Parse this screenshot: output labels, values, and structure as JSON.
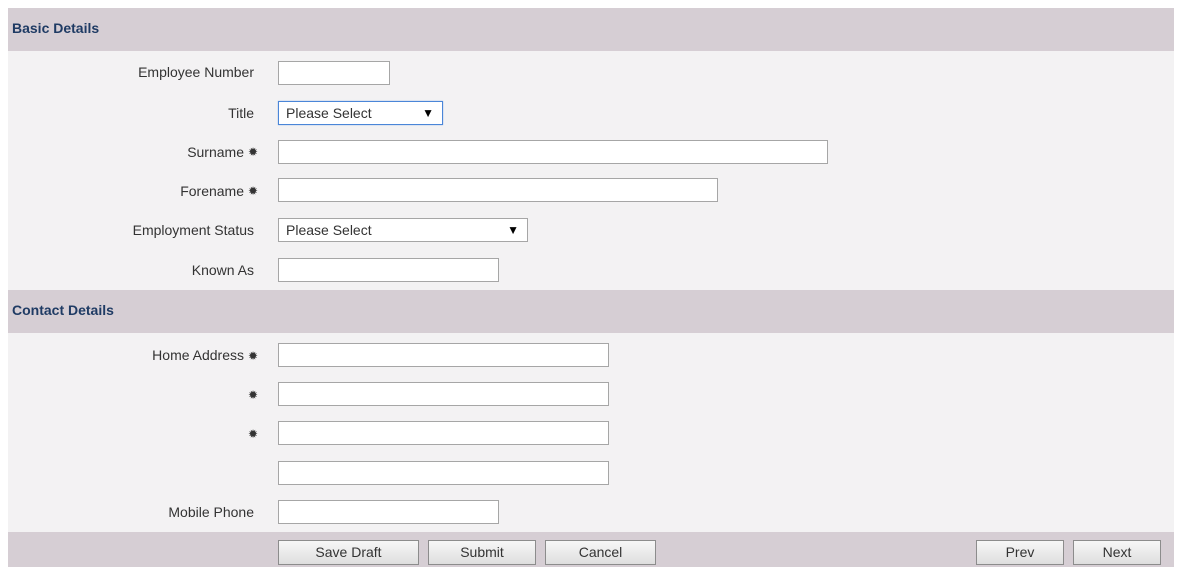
{
  "basic_details": {
    "title": "Basic Details",
    "fields": {
      "employee_number": {
        "label": "Employee Number",
        "value": ""
      },
      "title": {
        "label": "Title",
        "selected": "Please Select"
      },
      "surname": {
        "label": "Surname",
        "required_mark": "✹",
        "value": ""
      },
      "forename": {
        "label": "Forename",
        "required_mark": "✹",
        "value": ""
      },
      "employment_status": {
        "label": "Employment Status",
        "selected": "Please Select"
      },
      "known_as": {
        "label": "Known As",
        "value": ""
      }
    }
  },
  "contact_details": {
    "title": "Contact Details",
    "fields": {
      "home_address": {
        "label": "Home Address",
        "required_mark": "✹",
        "line1": "",
        "line2": "",
        "line3": "",
        "line4": ""
      },
      "address_line2_required_mark": "✹",
      "address_line3_required_mark": "✹",
      "mobile_phone": {
        "label": "Mobile Phone",
        "value": ""
      }
    }
  },
  "footer": {
    "save_draft": "Save Draft",
    "submit": "Submit",
    "cancel": "Cancel",
    "prev": "Prev",
    "next": "Next"
  },
  "icons": {
    "caret": "▼"
  },
  "colors": {
    "section_header_bg": "#d6ced4",
    "section_title": "#1f3b64",
    "form_bg": "#f3f2f3",
    "focus_border": "#4a86d8"
  }
}
